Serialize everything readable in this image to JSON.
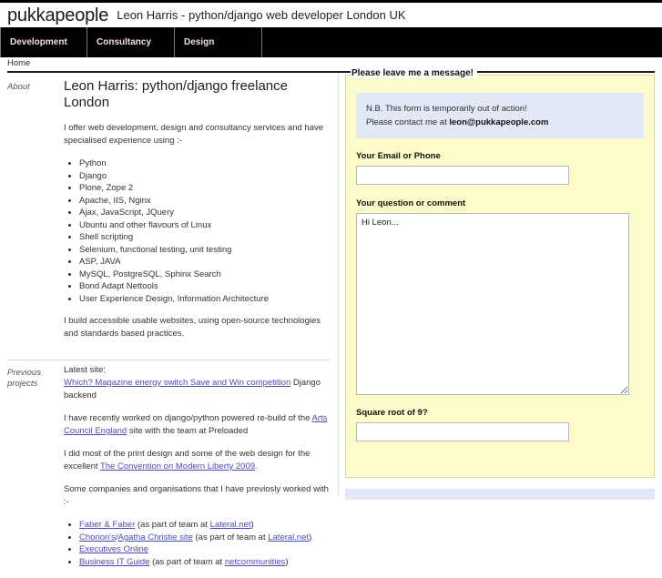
{
  "site": {
    "brand": "pukkapeople",
    "tagline": "Leon Harris - python/django web developer London UK"
  },
  "nav": {
    "items": [
      {
        "label": "Development"
      },
      {
        "label": "Consultancy"
      },
      {
        "label": "Design"
      }
    ]
  },
  "breadcrumb": {
    "current": "Home"
  },
  "about": {
    "label": "About",
    "heading": "Leon Harris: python/django freelance London",
    "intro": "I offer web development, design and consultancy services and have specialised experience using :-",
    "skills": [
      "Python",
      "Django",
      "Plone, Zope 2",
      "Apache, IIS, Nginx",
      "Ajax, JavaScript, JQuery",
      "Ubuntu and other flavours of Linux",
      "Shell scripting",
      "Selenium, functional testing, unit testing",
      "ASP, JAVA",
      "MySQL, PostgreSQL, Sphinx Search",
      "Bond Adapt Nettools",
      "User Experience Design, Information Architecture"
    ],
    "outro": "I build accessible usable websites, using open-source technologies and standards based practices."
  },
  "projects": {
    "label_line1": "Previous",
    "label_line2": "projects",
    "latest_prefix": "Latest site:",
    "latest_link": "Which? Magazine energy switch Save and Win competition",
    "latest_suffix": " Django backend",
    "recent_prefix": "I have recently worked on django/python powered re-build of the ",
    "recent_link": "Arts Council England",
    "recent_suffix": " site with the team at Preloaded",
    "print_prefix": "I did most of the print design and some of the web design for the excellent ",
    "print_link": "The Convention on Modern Liberty 2009",
    "print_suffix": ".",
    "companies_intro": "Some companies and organisations that I have previosly worked with :-",
    "companies": [
      {
        "link": "Faber & Faber",
        "mid": " (as part of team at ",
        "link2": "Lateral.net",
        "end": ")"
      },
      {
        "link": "Chorion's",
        "mid": "/",
        "link2": "Agatha Christie site",
        "mid2": " (as part of team at ",
        "link3": "Lateral.net",
        "end": ")"
      },
      {
        "link": "Executives Online",
        "mid": "",
        "end": ""
      },
      {
        "link": "Business IT Guide",
        "mid": " (as part of team at ",
        "link2": "netcommunities",
        "end": ")"
      }
    ]
  },
  "form": {
    "legend": "Please leave me a message!",
    "notice_line1": "N.B. This form is temporarily out of action!",
    "notice_line2_prefix": "Please contact me at ",
    "notice_email": "leon@pukkapeople.com",
    "email_label": "Your Email or Phone",
    "email_value": "",
    "email_placeholder": "",
    "comment_label": "Your question or comment",
    "comment_value": "Hi Leon...",
    "captcha_label": "Square root of 9?",
    "captcha_value": "",
    "captcha_placeholder": ""
  },
  "colors": {
    "nav_bg": "#000000",
    "nav_text": "#f6dede",
    "form_bg": "#fcfccb",
    "notice_bg": "#e3e8f7",
    "link": "#4b4bbd"
  }
}
